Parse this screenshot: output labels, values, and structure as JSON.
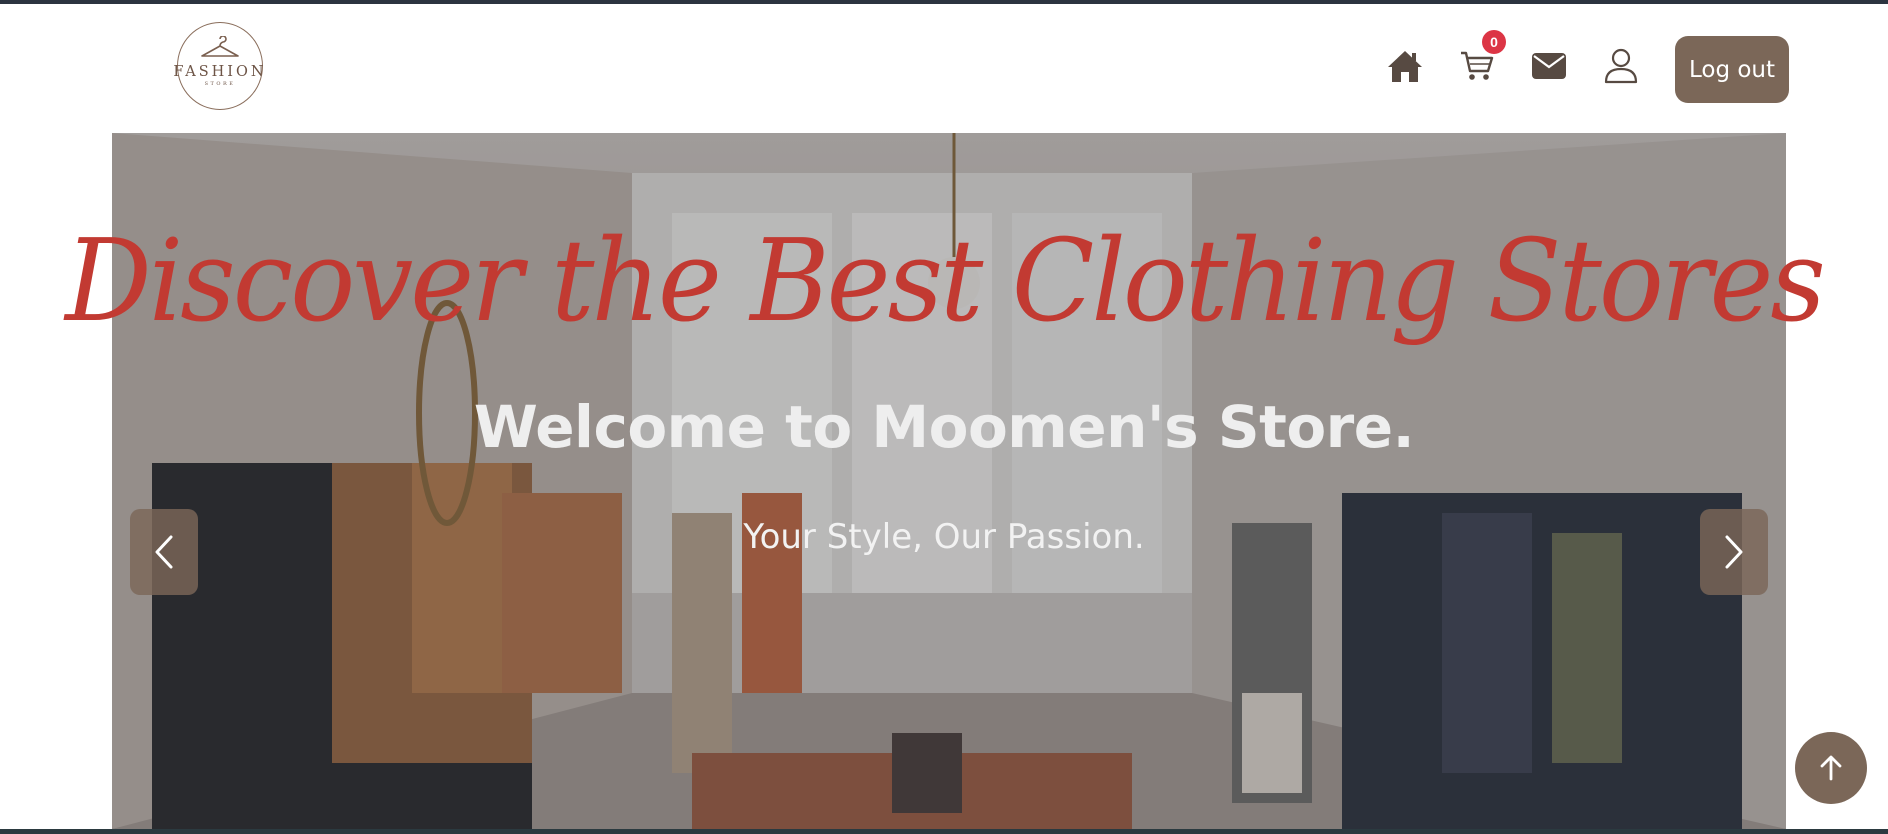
{
  "header": {
    "logo": {
      "text": "FASHION",
      "subtext": "STORE"
    },
    "nav": {
      "home_icon": "home-icon",
      "cart_icon": "cart-icon",
      "cart_count": "0",
      "mail_icon": "mail-icon",
      "user_icon": "user-icon"
    },
    "logout_label": "Log out"
  },
  "hero": {
    "script_title": "Discover the Best Clothing Stores",
    "welcome": "Welcome to Moomen's Store.",
    "tagline": "Your Style, Our Passion.",
    "prev_icon": "chevron-left-icon",
    "next_icon": "chevron-right-icon"
  },
  "scroll_top_icon": "arrow-up-icon",
  "colors": {
    "brand": "#7b6758",
    "badge": "#dc3545",
    "script": "#c23a32",
    "icon": "#574a42"
  }
}
